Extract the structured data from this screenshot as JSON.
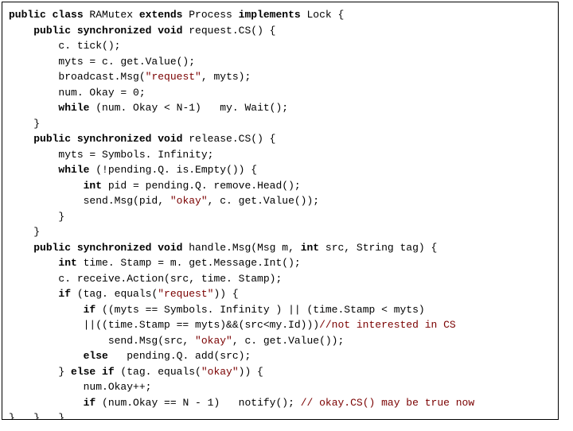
{
  "code": {
    "l1_kw1": "public class",
    "l1_t1": " RAMutex ",
    "l1_kw2": "extends",
    "l1_t2": " Process ",
    "l1_kw3": "implements",
    "l1_t3": " Lock {",
    "l2_pad": "    ",
    "l2_kw": "public synchronized void",
    "l2_t": " request.CS() {",
    "l3": "        c. tick();",
    "l4": "        myts = c. get.Value();",
    "l5_a": "        broadcast.Msg(",
    "l5_s": "\"request\"",
    "l5_b": ", myts);",
    "l6": "        num. Okay = 0;",
    "l7_a": "        ",
    "l7_kw": "while",
    "l7_b": " (num. Okay < N-1)   my. Wait();",
    "l8": "    }",
    "l9_pad": "    ",
    "l9_kw": "public synchronized void",
    "l9_t": " release.CS() {",
    "l10": "        myts = Symbols. Infinity;",
    "l11_a": "        ",
    "l11_kw": "while",
    "l11_b": " (!pending.Q. is.Empty()) {",
    "l12_a": "            ",
    "l12_kw": "int",
    "l12_b": " pid = pending.Q. remove.Head();",
    "l13_a": "            send.Msg(pid, ",
    "l13_s": "\"okay\"",
    "l13_b": ", c. get.Value());",
    "l14": "        }",
    "l15": "    }",
    "l16_pad": "    ",
    "l16_kw1": "public synchronized void",
    "l16_t1": " handle.Msg(Msg m, ",
    "l16_kw2": "int",
    "l16_t2": " src, String tag) {",
    "l17_a": "        ",
    "l17_kw": "int",
    "l17_b": " time. Stamp = m. get.Message.Int();",
    "l18": "        c. receive.Action(src, time. Stamp);",
    "l19_a": "        ",
    "l19_kw": "if",
    "l19_b": " (tag. equals(",
    "l19_s": "\"request\"",
    "l19_c": ")) {",
    "l20_a": "            ",
    "l20_kw": "if",
    "l20_b": " ((myts == Symbols. Infinity ) || (time.Stamp < myts)",
    "l21_a": "            ||((time.Stamp == myts)&&(src<my.Id)))",
    "l21_c": "//not interested in CS",
    "l22_a": "                send.Msg(src, ",
    "l22_s": "\"okay\"",
    "l22_b": ", c. get.Value());",
    "l23_a": "            ",
    "l23_kw": "else",
    "l23_b": "   pending.Q. add(src);",
    "l24_a": "        } ",
    "l24_kw": "else if",
    "l24_b": " (tag. equals(",
    "l24_s": "\"okay\"",
    "l24_c": ")) {",
    "l25": "            num.Okay++;",
    "l26_a": "            ",
    "l26_kw": "if",
    "l26_b": " (num.Okay == N - 1)   notify(); ",
    "l26_c": "// okay.CS() may be true now",
    "l27": "}   }   }"
  }
}
